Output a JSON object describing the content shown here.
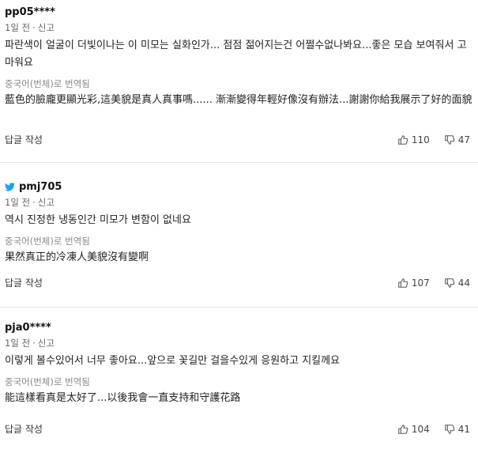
{
  "comments": [
    {
      "author": "pp05****",
      "time": "1일 전",
      "report_label": "신고",
      "original_text": "파란색이 얼굴이 더빛이나는 이 미모는 실화인가... 점점 젊어지는건 어쩔수없나봐요...좋은 모습 보여줘서 고마워요",
      "translation_label": "중국어(번체)로 번역됨",
      "translated_text": "藍色的臉龐更顯光彩,這美貌是真人真事嗎...... 漸漸變得年輕好像沒有辦法...謝謝你給我展示了好的面貌",
      "reply_label": "답글 작성",
      "likes": "110",
      "dislikes": "47"
    },
    {
      "author": "pmj705",
      "twitter": true,
      "time": "1일 전",
      "report_label": "신고",
      "original_text": "역시 진정한 냉동인간 미모가 변함이 없네요",
      "translation_label": "중국어(번체)로 번역됨",
      "translated_text": "果然真正的冷凍人美貌沒有變啊",
      "reply_label": "답글 작성",
      "likes": "107",
      "dislikes": "44"
    },
    {
      "author": "pja0****",
      "time": "1일 전",
      "report_label": "신고",
      "original_text": "이렇게 볼수있어서 너무 좋아요...앞으로 꽃길만 걸을수있게 응원하고 지킬께요",
      "translation_label": "중국어(번체)로 번역됨",
      "translated_text": "能這樣看真是太好了...以後我會一直支持和守護花路",
      "reply_label": "답글 작성",
      "likes": "104",
      "dislikes": "41"
    }
  ],
  "colors": {
    "twitter": "#1da1f2",
    "divider": "#e6e6e6",
    "meta": "#666666"
  },
  "icons": {
    "like": "thumbs-up-icon",
    "dislike": "thumbs-down-icon",
    "twitter": "twitter-bird-icon"
  }
}
